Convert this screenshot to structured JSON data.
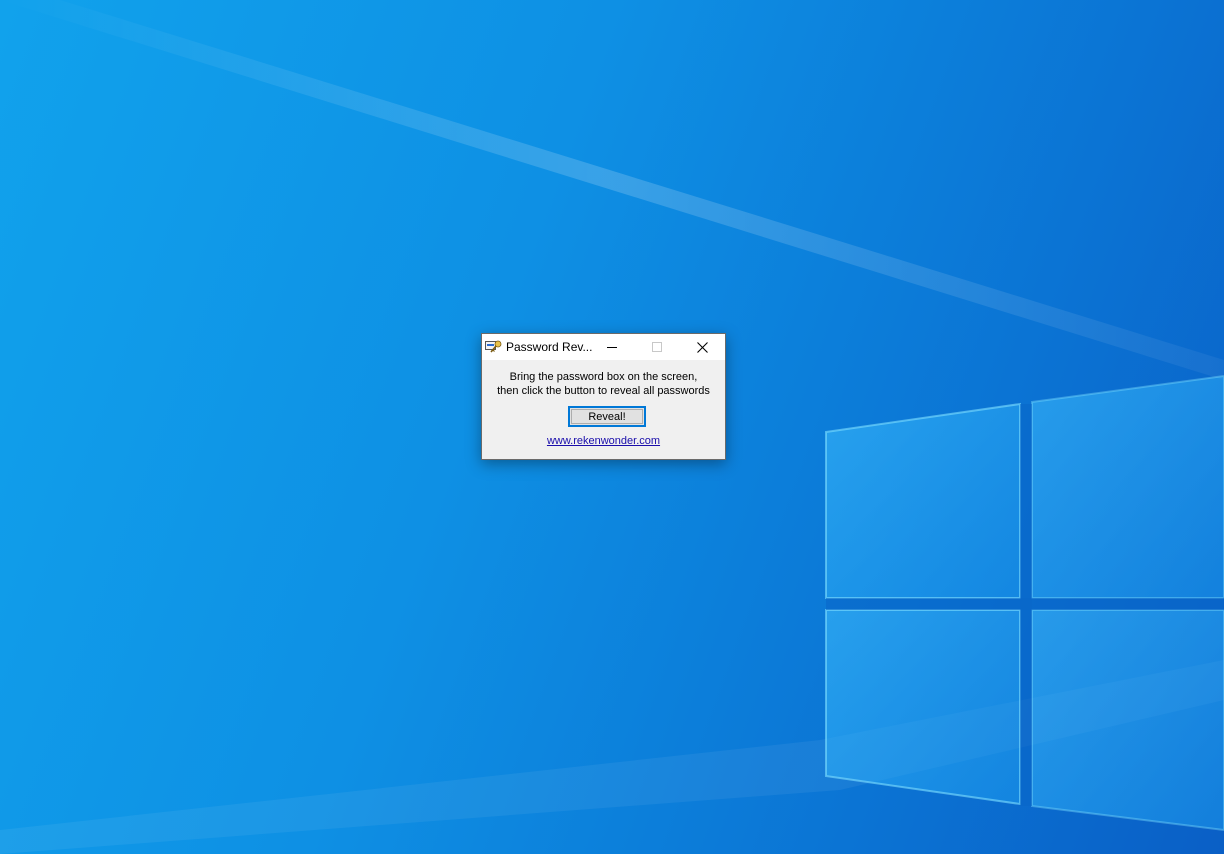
{
  "desktop": {
    "wallpaper": "windows-10-hero",
    "colors": {
      "base": "#0e90e4",
      "logo_light": "#47c8ff",
      "logo_dark": "#1a8fe8"
    }
  },
  "window": {
    "title": "Password Rev...",
    "icon": "password-reveal-app-icon",
    "controls": {
      "minimize": "minimize-icon",
      "maximize": "maximize-icon",
      "close": "close-icon"
    },
    "message_line1": "Bring the password box on the screen,",
    "message_line2": "then click the button to reveal all passwords",
    "button_label": "Reveal!",
    "link_text": "www.rekenwonder.com",
    "accent_color": "#0078d7"
  }
}
